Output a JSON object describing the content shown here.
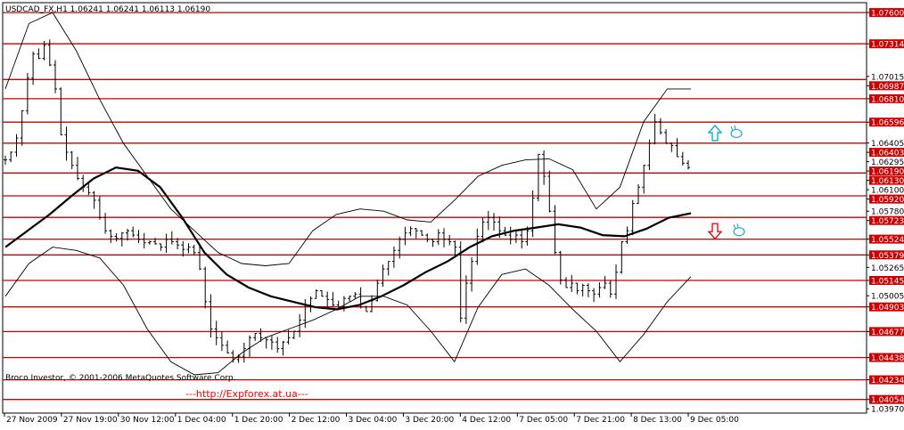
{
  "header": {
    "symbol_info": "USDCAD_FX,H1  1.06241 1.06241 1.06113 1.06190"
  },
  "footer": {
    "credit": "Broco Investor, © 2001-2006 MetaQuotes Software Corp.",
    "watermark": "---http://Expforex.at.ua---"
  },
  "colors": {
    "background": "#ffffff",
    "candles": "#000000",
    "level_lines": "#cc0000",
    "level_label_bg": "#cc0000",
    "level_label_text": "#ffffff",
    "up_arrow": "#00aacc",
    "down_arrow": "#dd0000",
    "hand_icon": "#22aacc"
  },
  "signals": [
    {
      "name": "up-arrow-icon",
      "level": 1.065,
      "time_index": 0.52
    },
    {
      "name": "down-arrow-icon",
      "level": 1.056,
      "time_index": 0.52
    }
  ],
  "chart_data": {
    "type": "candlestick",
    "title": "",
    "ylim": [
      1.0397,
      1.0765
    ],
    "price_labels": [
      "1.07600",
      "1.07314",
      "1.07015",
      "1.06987",
      "1.06810",
      "1.06596",
      "1.06405",
      "1.06403",
      "1.06295",
      "1.06190",
      "1.06130",
      "1.06100",
      "1.05920",
      "1.05780",
      "1.05723",
      "1.05524",
      "1.05379",
      "1.05265",
      "1.05145",
      "1.05005",
      "1.04903",
      "1.04677",
      "1.04438",
      "1.04234",
      "1.04054",
      "1.03970"
    ],
    "resistance_support_levels": [
      1.076,
      1.07314,
      1.06987,
      1.0681,
      1.06596,
      1.06403,
      1.0613,
      1.0592,
      1.05723,
      1.05524,
      1.05379,
      1.05145,
      1.04903,
      1.04677,
      1.04438,
      1.04234,
      1.04054
    ],
    "highlighted_levels": [
      "1.07600",
      "1.07314",
      "1.06987",
      "1.06810",
      "1.06596",
      "1.06403",
      "1.06190",
      "1.06130",
      "1.05920",
      "1.05723",
      "1.05524",
      "1.05379",
      "1.05145",
      "1.04903",
      "1.04677",
      "1.04438",
      "1.04234",
      "1.04054"
    ],
    "plain_tick_labels": [
      "1.07015",
      "1.06295",
      "1.06100",
      "1.05780",
      "1.05265",
      "1.05005",
      "1.03970"
    ],
    "x_tick_labels": [
      "27 Nov 2009",
      "27 Nov 19:00",
      "30 Nov 12:00",
      "1 Dec 04:00",
      "1 Dec 20:00",
      "2 Dec 12:00",
      "3 Dec 04:00",
      "3 Dec 20:00",
      "4 Dec 12:00",
      "7 Dec 05:00",
      "7 Dec 21:00",
      "8 Dec 13:00",
      "9 Dec 05:00"
    ],
    "close_series": [
      1.0625,
      1.0632,
      1.0645,
      1.067,
      1.07,
      1.0722,
      1.0718,
      1.073,
      1.0712,
      1.069,
      1.0648,
      1.0632,
      1.062,
      1.0608,
      1.06,
      1.0595,
      1.0588,
      1.0572,
      1.056,
      1.0555,
      1.0553,
      1.0558,
      1.056,
      1.0556,
      1.0552,
      1.0549,
      1.055,
      1.0548,
      1.0545,
      1.0552,
      1.055,
      1.0547,
      1.0543,
      1.0545,
      1.054,
      1.0525,
      1.0495,
      1.047,
      1.0462,
      1.0455,
      1.0448,
      1.0442,
      1.0445,
      1.0452,
      1.0462,
      1.0466,
      1.0462,
      1.046,
      1.0458,
      1.0452,
      1.0458,
      1.0462,
      1.0468,
      1.0478,
      1.0492,
      1.0498,
      1.0505,
      1.05,
      1.0497,
      1.0492,
      1.049,
      1.0498,
      1.05,
      1.0502,
      1.049,
      1.0486,
      1.0496,
      1.0512,
      1.0525,
      1.0532,
      1.0542,
      1.0552,
      1.0558,
      1.0562,
      1.056,
      1.0556,
      1.0552,
      1.055,
      1.0558,
      1.0552,
      1.055,
      1.0545,
      1.048,
      1.0512,
      1.0532,
      1.0555,
      1.0568,
      1.0572,
      1.0568,
      1.056,
      1.0556,
      1.0552,
      1.0556,
      1.055,
      1.056,
      1.059,
      1.063,
      1.061,
      1.0578,
      1.054,
      1.0515,
      1.0508,
      1.0512,
      1.0505,
      1.051,
      1.0505,
      1.0502,
      1.0508,
      1.0512,
      1.0502,
      1.0522,
      1.055,
      1.056,
      1.0585,
      1.06,
      1.062,
      1.064,
      1.066,
      1.065,
      1.064,
      1.0638,
      1.0628,
      1.0622,
      1.0618
    ],
    "moving_average_thick": [
      1.0545,
      1.056,
      1.0575,
      1.0592,
      1.0608,
      1.0618,
      1.0615,
      1.06,
      1.0572,
      1.054,
      1.052,
      1.0508,
      1.05,
      1.0495,
      1.049,
      1.0488,
      1.0492,
      1.05,
      1.051,
      1.0522,
      1.0532,
      1.0545,
      1.0555,
      1.056,
      1.0563,
      1.0566,
      1.0563,
      1.0556,
      1.0555,
      1.0562,
      1.0572,
      1.0576
    ],
    "bollinger_upper": [
      1.069,
      1.075,
      1.076,
      1.0725,
      1.068,
      1.064,
      1.061,
      1.058,
      1.056,
      1.054,
      1.053,
      1.0528,
      1.053,
      1.056,
      1.0575,
      1.058,
      1.0578,
      1.057,
      1.0568,
      1.0588,
      1.061,
      1.062,
      1.0625,
      1.0626,
      1.0616,
      1.058,
      1.06,
      1.066,
      1.069,
      1.069
    ],
    "bollinger_lower": [
      1.05,
      1.053,
      1.0545,
      1.0542,
      1.0535,
      1.051,
      1.047,
      1.044,
      1.0428,
      1.043,
      1.0448,
      1.0462,
      1.047,
      1.0478,
      1.0488,
      1.05,
      1.05,
      1.0492,
      1.0468,
      1.044,
      1.049,
      1.052,
      1.0525,
      1.051,
      1.0488,
      1.0468,
      1.044,
      1.0465,
      1.0495,
      1.0518
    ],
    "grid": false
  }
}
